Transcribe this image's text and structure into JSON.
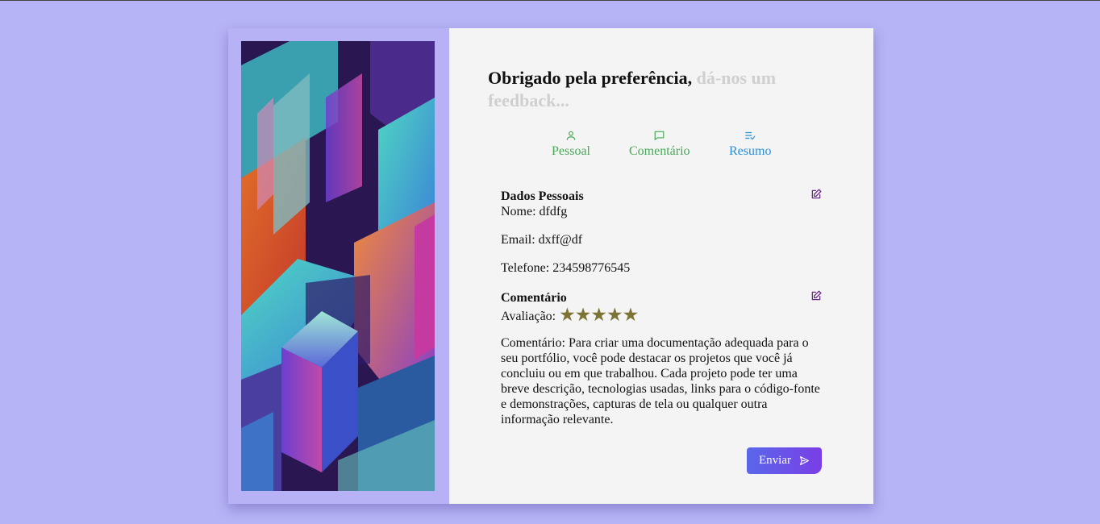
{
  "header": {
    "title_main": "Obrigado pela preferência,",
    "title_faded": "dá-nos um feedback..."
  },
  "steps": [
    {
      "label": "Pessoal",
      "icon": "user-icon",
      "color": "#47a858"
    },
    {
      "label": "Comentário",
      "icon": "message-icon",
      "color": "#47a858"
    },
    {
      "label": "Resumo",
      "icon": "list-check-icon",
      "color": "#2b8ed8"
    }
  ],
  "personal": {
    "heading": "Dados Pessoais",
    "name_label": "Nome:",
    "name_value": "dfdfg",
    "email_label": "Email:",
    "email_value": "dxff@df",
    "phone_label": "Telefone:",
    "phone_value": "234598776545"
  },
  "review": {
    "heading": "Comentário",
    "rating_label": "Avaliação:",
    "rating_stars": "★★★★★",
    "rating_value": 5,
    "comment_label": "Comentário:",
    "comment_text": "Para criar uma documentação adequada para o seu portfólio, você pode destacar os projetos que você já concluiu ou em que trabalhou. Cada projeto pode ter uma breve descrição, tecnologias usadas, links para o código-fonte e demonstrações, capturas de tela ou qualquer outra informação relevante."
  },
  "actions": {
    "send_label": "Enviar"
  },
  "colors": {
    "background": "#b6b3f6",
    "step_done": "#47a858",
    "step_active": "#2b8ed8",
    "star": "#7c7335",
    "edit_icon": "#6b2a8a",
    "button_gradient_start": "#5a67ea",
    "button_gradient_end": "#7a3ee6"
  }
}
